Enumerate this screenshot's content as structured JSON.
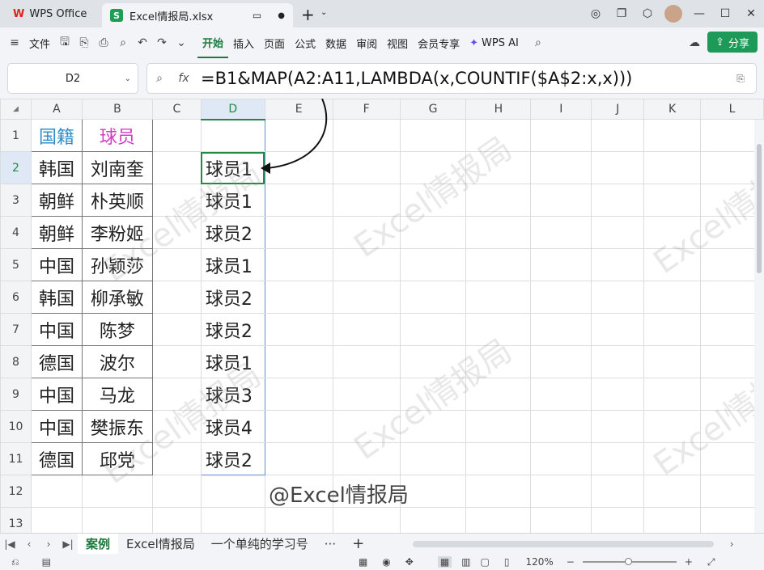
{
  "titlebar": {
    "app_name": "WPS Office",
    "file_name": "Excel情报局.xlsx",
    "logo_w": "W",
    "logo_s": "S"
  },
  "menubar": {
    "file": "文件",
    "tabs": [
      "开始",
      "插入",
      "页面",
      "公式",
      "数据",
      "审阅",
      "视图",
      "会员专享",
      "WPS AI"
    ],
    "share": "分享"
  },
  "formula": {
    "cell_ref": "D2",
    "fx_label": "fx",
    "text": "=B1&MAP(A2:A11,LAMBDA(x,COUNTIF($A$2:x,x)))"
  },
  "columns": [
    "A",
    "B",
    "C",
    "D",
    "E",
    "F",
    "G",
    "H",
    "I",
    "J",
    "K",
    "L"
  ],
  "rows": [
    "1",
    "2",
    "3",
    "4",
    "5",
    "6",
    "7",
    "8",
    "9",
    "10",
    "11",
    "12",
    "13"
  ],
  "cells": {
    "A": [
      "国籍",
      "韩国",
      "朝鲜",
      "朝鲜",
      "中国",
      "韩国",
      "中国",
      "德国",
      "中国",
      "中国",
      "德国"
    ],
    "B": [
      "球员",
      "刘南奎",
      "朴英顺",
      "李粉姬",
      "孙颖莎",
      "柳承敏",
      "陈梦",
      "波尔",
      "马龙",
      "樊振东",
      "邱党"
    ],
    "D": [
      "",
      "球员1",
      "球员1",
      "球员2",
      "球员1",
      "球员2",
      "球员2",
      "球员1",
      "球员3",
      "球员4",
      "球员2"
    ]
  },
  "watermark": "Excel情报局",
  "signature": "@Excel情报局",
  "sheets": {
    "tabs": [
      "案例",
      "Excel情报局",
      "一个单纯的学习号"
    ],
    "more": "···",
    "add": "+"
  },
  "status": {
    "zoom": "120%",
    "minus": "−",
    "plus": "+"
  },
  "colors": {
    "accent": "#1d7a3c",
    "header_blue": "#2e8fc9",
    "header_pink": "#d33cc2"
  }
}
